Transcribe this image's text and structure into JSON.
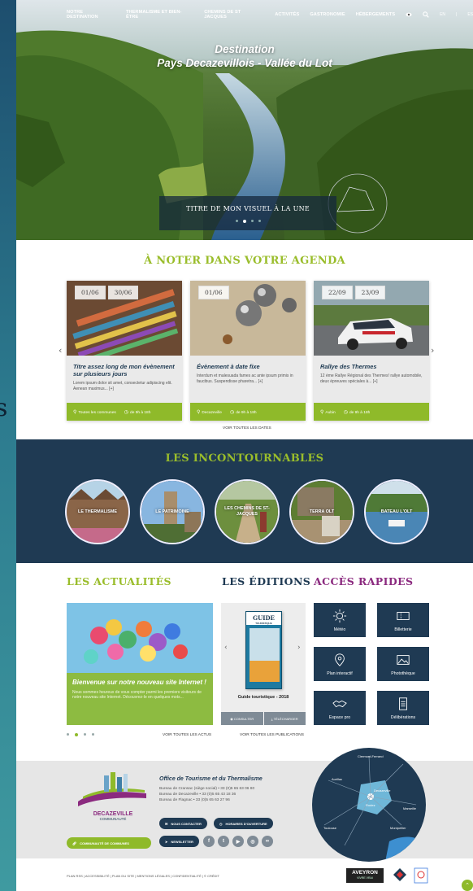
{
  "nav": {
    "items": [
      "Notre destination",
      "Thermalisme et bien-être",
      "Chemins de St Jacques",
      "Activités",
      "Gastronomie",
      "Hébergements"
    ],
    "lang_en": "EN",
    "lang_sep": "|",
    "lang_es": "ES"
  },
  "hero": {
    "title_line1": "Destination",
    "title_line2": "Pays Decazevillois - Vallée du Lot",
    "caption": "TITRE DE MON VISUEL À LA UNE",
    "active_slide": 2,
    "slide_count": 4
  },
  "agenda": {
    "title": "À NOTER DANS VOTRE AGENDA",
    "see_all": "Voir toutes les dates",
    "cards": [
      {
        "date_start": "01/06",
        "date_end": "30/06",
        "title": "Titre assez long de mon évènement sur plusieurs jours",
        "text": "Lorem ipsum dolor sit amet, consectetur adipiscing elit. Aenean maximus... [+]",
        "place": "Toutes les communes",
        "time": "de 9h à 18h"
      },
      {
        "date_start": "01/06",
        "title": "Évènement à date fixe",
        "text": "Interdum et malesuada fames ac ante ipsum primis in faucibus. Suspendisse pharetra... [+]",
        "place": "Decazeville",
        "time": "de 9h à 18h"
      },
      {
        "date_start": "22/09",
        "date_end": "23/09",
        "title": "Rallye des Thermes",
        "text": "12 ème Rallye Régional des Thermes! rallye automobile, deux épreuves spéciales à... [+]",
        "place": "Aubin",
        "time": "de 9h à 18h"
      }
    ]
  },
  "incontournables": {
    "title": "LES INCONTOURNABLES",
    "items": [
      "Le Thermalisme",
      "Le Patrimoine",
      "Les chemins de St-Jacques",
      "Terra Olt",
      "Bateau l'Olt"
    ]
  },
  "actualites": {
    "title": "LES ACTUALITÉS",
    "news_title": "Bienvenue sur notre nouveau site Internet !",
    "news_text": "Nous sommes heureux de vous compter parmi les premiers visiteurs de notre nouveau site Internet. Découvrez-le en quelques mots...",
    "see_all": "Voir toutes les actus",
    "active_page": 2,
    "page_count": 4
  },
  "editions": {
    "title": "LES ÉDITIONS",
    "book_title": "GUIDE",
    "book_sub": "TOURISTIQUE",
    "name": "Guide touristique - 2018",
    "consult": "Consulter",
    "download": "Télécharger",
    "see_all": "Voir toutes les publications"
  },
  "acces": {
    "title": "ACCÈS RAPIDES",
    "items": [
      "Météo",
      "Billetterie",
      "Plan interactif",
      "Photothèque",
      "Espace pro",
      "Délibérations"
    ]
  },
  "footer": {
    "logo_name": "DECAZEVILLE",
    "logo_sub": "COMMUNAUTÉ",
    "community_btn": "Communauté de communes",
    "office_title": "Office de Tourisme et du Thermalisme",
    "lines": [
      "Bureau de Cransac (siège social) • 33 (0)5 65 63 06 80",
      "Bureau de Decazeville • 33 (0)5 65 43 18 36",
      "Bureau de Flagnac • 33 (0)5 65 63 27 96"
    ],
    "contact_btn": "Nous contacter",
    "hours_btn": "Horaires d'ouverture",
    "newsletter_btn": "Newsletter",
    "legal": "Plan rss  |  Accessibilité  |  Plan du site  |  Mentions légales  |  Confidentialité  |  © Crédit",
    "aveyron": "AVEYRON",
    "aveyron_sub": "VIVRE VRAI",
    "map_labels": [
      "Decazeville",
      "Rodez",
      "Toulouse",
      "Montpellier",
      "Marseille",
      "Clermont-Ferrand",
      "Aurillac"
    ]
  },
  "colors": {
    "green": "#8fba2a",
    "navy": "#1f3a53"
  }
}
